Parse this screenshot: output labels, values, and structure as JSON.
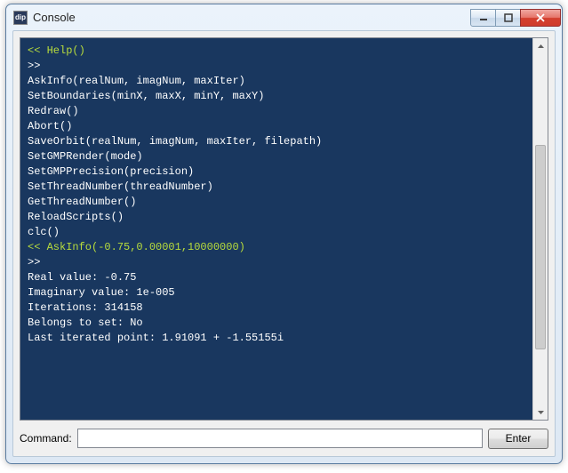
{
  "window": {
    "title": "Console",
    "app_icon_text": "dip"
  },
  "console": {
    "lines": [
      {
        "cls": "cmd-line",
        "text": "<< Help()"
      },
      {
        "cls": "prompt-line",
        "text": ">>"
      },
      {
        "cls": "prompt-line",
        "text": "AskInfo(realNum, imagNum, maxIter)"
      },
      {
        "cls": "prompt-line",
        "text": "SetBoundaries(minX, maxX, minY, maxY)"
      },
      {
        "cls": "prompt-line",
        "text": "Redraw()"
      },
      {
        "cls": "prompt-line",
        "text": "Abort()"
      },
      {
        "cls": "prompt-line",
        "text": "SaveOrbit(realNum, imagNum, maxIter, filepath)"
      },
      {
        "cls": "prompt-line",
        "text": "SetGMPRender(mode)"
      },
      {
        "cls": "prompt-line",
        "text": "SetGMPPrecision(precision)"
      },
      {
        "cls": "prompt-line",
        "text": "SetThreadNumber(threadNumber)"
      },
      {
        "cls": "prompt-line",
        "text": "GetThreadNumber()"
      },
      {
        "cls": "prompt-line",
        "text": "ReloadScripts()"
      },
      {
        "cls": "prompt-line",
        "text": "clc()"
      },
      {
        "cls": "prompt-line",
        "text": ""
      },
      {
        "cls": "cmd-line",
        "text": "<< AskInfo(-0.75,0.00001,10000000)"
      },
      {
        "cls": "prompt-line",
        "text": ">>"
      },
      {
        "cls": "prompt-line",
        "text": "Real value: -0.75"
      },
      {
        "cls": "prompt-line",
        "text": "Imaginary value: 1e-005"
      },
      {
        "cls": "prompt-line",
        "text": "Iterations: 314158"
      },
      {
        "cls": "prompt-line",
        "text": "Belongs to set: No"
      },
      {
        "cls": "prompt-line",
        "text": "Last iterated point: 1.91091 + -1.55155i"
      }
    ]
  },
  "command": {
    "label": "Command:",
    "value": "",
    "placeholder": ""
  },
  "buttons": {
    "enter": "Enter"
  }
}
